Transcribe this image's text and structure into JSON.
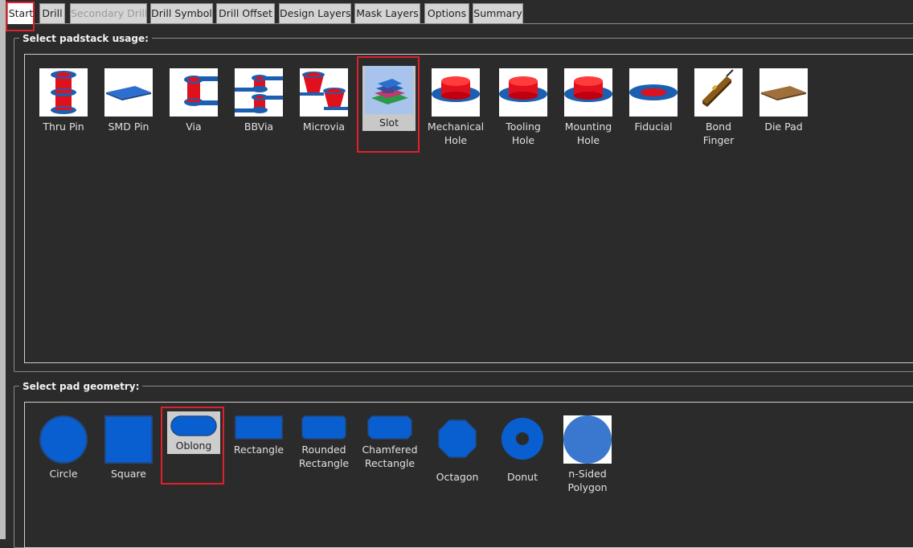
{
  "tabs": [
    {
      "label": "Start",
      "state": "active"
    },
    {
      "label": "Drill",
      "state": "normal"
    },
    {
      "label": "Secondary Drill",
      "state": "disabled"
    },
    {
      "label": "Drill Symbol",
      "state": "normal"
    },
    {
      "label": "Drill Offset",
      "state": "normal"
    },
    {
      "label": "Design Layers",
      "state": "normal"
    },
    {
      "label": "Mask Layers",
      "state": "normal"
    },
    {
      "label": "Options",
      "state": "normal"
    },
    {
      "label": "Summary",
      "state": "normal"
    }
  ],
  "usage": {
    "title": "Select padstack usage:",
    "selected": "Slot",
    "items": [
      {
        "label": "Thru Pin",
        "icon": "thru-pin-icon"
      },
      {
        "label": "SMD Pin",
        "icon": "smd-pin-icon"
      },
      {
        "label": "Via",
        "icon": "via-icon"
      },
      {
        "label": "BBVia",
        "icon": "bbvia-icon"
      },
      {
        "label": "Microvia",
        "icon": "microvia-icon"
      },
      {
        "label": "Slot",
        "icon": "slot-icon"
      },
      {
        "label": "Mechanical\nHole",
        "icon": "mechanical-hole-icon"
      },
      {
        "label": "Tooling\nHole",
        "icon": "tooling-hole-icon"
      },
      {
        "label": "Mounting\nHole",
        "icon": "mounting-hole-icon"
      },
      {
        "label": "Fiducial",
        "icon": "fiducial-icon"
      },
      {
        "label": "Bond\nFinger",
        "icon": "bond-finger-icon"
      },
      {
        "label": "Die Pad",
        "icon": "die-pad-icon"
      }
    ]
  },
  "geometry": {
    "title": "Select pad geometry:",
    "selected": "Oblong",
    "items": [
      {
        "label": "Circle",
        "icon": "circle-icon"
      },
      {
        "label": "Square",
        "icon": "square-icon"
      },
      {
        "label": "Oblong",
        "icon": "oblong-icon"
      },
      {
        "label": "Rectangle",
        "icon": "rectangle-icon"
      },
      {
        "label": "Rounded\nRectangle",
        "icon": "rounded-rectangle-icon"
      },
      {
        "label": "Chamfered\nRectangle",
        "icon": "chamfered-rectangle-icon"
      },
      {
        "label": "Octagon",
        "icon": "octagon-icon"
      },
      {
        "label": "Donut",
        "icon": "donut-icon"
      },
      {
        "label": "n-Sided\nPolygon",
        "icon": "n-sided-polygon-icon"
      }
    ]
  },
  "colors": {
    "highlight": "#e0202a",
    "copper_red": "#e0101c",
    "pad_blue": "#0a5fd0",
    "background": "#2b2b2b"
  }
}
